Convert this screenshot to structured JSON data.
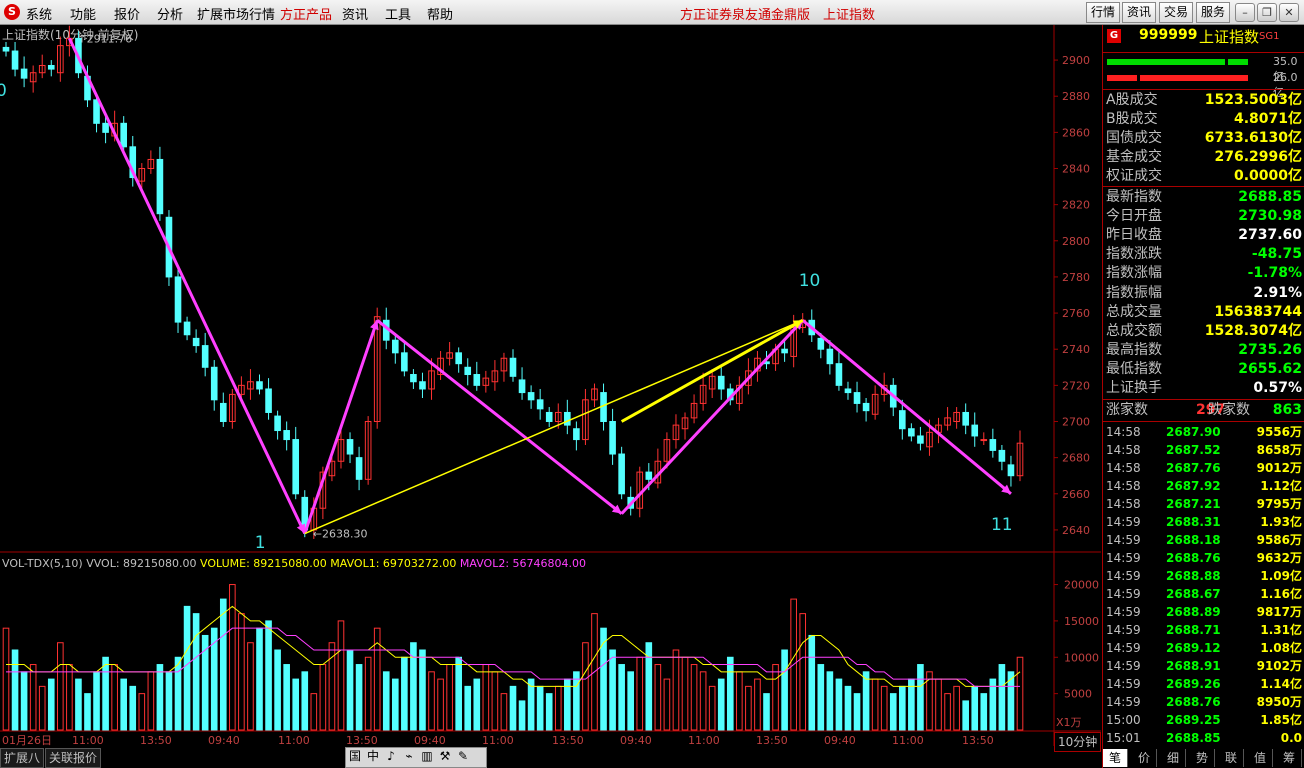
{
  "menu": {
    "items": [
      "系统",
      "功能",
      "报价",
      "分析",
      "扩展市场行情",
      "方正产品",
      "资讯",
      "工具",
      "帮助"
    ],
    "center_title": "方正证券泉友通金鼎版　上证指数",
    "right_buttons": [
      "行情",
      "资讯",
      "交易",
      "服务"
    ]
  },
  "chart": {
    "title": "上证指数(10分钟 前复权)",
    "high_label": "2911.76",
    "low_label": "2638.30",
    "wave_labels": [
      "0",
      "1",
      "10",
      "11"
    ],
    "price_axis": [
      "2900",
      "2880",
      "2860",
      "2840",
      "2820",
      "2800",
      "2780",
      "2760",
      "2740",
      "2720",
      "2700",
      "2680",
      "2660",
      "2640"
    ],
    "vol_axis": [
      "20000",
      "15000",
      "10000",
      "5000"
    ],
    "vol_unit": "X1万",
    "period": "10分钟",
    "time_axis": [
      "01月26日",
      "11:00",
      "13:50",
      "09:40",
      "11:00",
      "13:50",
      "09:40",
      "11:00",
      "13:50",
      "09:40",
      "11:00",
      "13:50",
      "09:40",
      "11:00",
      "13:50"
    ],
    "vol_header": {
      "name": "VOL-TDX(5,10)",
      "vvol": "VVOL: 89215080.00",
      "volume": "VOLUME: 89215080.00",
      "mavol1": "MAVOL1: 69703272.00",
      "mavol2": "MAVOL2: 56746804.00"
    },
    "colors": {
      "up": "#ff3232",
      "down": "#54ffff",
      "ma1": "#ffff00",
      "ma2": "#ff40ff",
      "trend": "#ff40ff",
      "yellow_line": "#ffff00",
      "grid": "#a00000"
    }
  },
  "bottom_tabs": [
    "扩展八",
    "关联报价"
  ],
  "toolstrip": [
    "国",
    "中",
    "♪",
    "⌁",
    "▥",
    "⚒",
    "✎"
  ],
  "panel": {
    "code": "999999",
    "name": "上证指数",
    "tag": "SG1",
    "bar1_label": "35.0亿",
    "bar2_label": "26.0亿",
    "turnover": [
      {
        "k": "A股成交",
        "v": "1523.5003亿"
      },
      {
        "k": "B股成交",
        "v": "4.8071亿"
      },
      {
        "k": "国债成交",
        "v": "6733.6130亿"
      },
      {
        "k": "基金成交",
        "v": "276.2996亿"
      },
      {
        "k": "权证成交",
        "v": "0.0000亿"
      }
    ],
    "stats": [
      {
        "k": "最新指数",
        "v": "2688.85",
        "c": "#00ff00"
      },
      {
        "k": "今日开盘",
        "v": "2730.98",
        "c": "#00ff00"
      },
      {
        "k": "昨日收盘",
        "v": "2737.60",
        "c": "#ffffff"
      },
      {
        "k": "指数涨跌",
        "v": "-48.75",
        "c": "#00ff00"
      },
      {
        "k": "指数涨幅",
        "v": "-1.78%",
        "c": "#00ff00"
      },
      {
        "k": "指数振幅",
        "v": "2.91%",
        "c": "#ffffff"
      },
      {
        "k": "总成交量",
        "v": "156383744",
        "c": "#ffff00"
      },
      {
        "k": "总成交额",
        "v": "1528.3074亿",
        "c": "#ffff00"
      },
      {
        "k": "最高指数",
        "v": "2735.26",
        "c": "#00ff00"
      },
      {
        "k": "最低指数",
        "v": "2655.62",
        "c": "#00ff00"
      },
      {
        "k": "上证换手",
        "v": "0.57%",
        "c": "#ffffff"
      }
    ],
    "updown": {
      "up_label": "涨家数",
      "up": "297",
      "down_label": "跌家数",
      "down": "863"
    },
    "ticks": [
      {
        "t": "14:58",
        "p": "2687.90",
        "q": "9556万"
      },
      {
        "t": "14:58",
        "p": "2687.52",
        "q": "8658万"
      },
      {
        "t": "14:58",
        "p": "2687.76",
        "q": "9012万"
      },
      {
        "t": "14:58",
        "p": "2687.92",
        "q": "1.12亿"
      },
      {
        "t": "14:58",
        "p": "2687.21",
        "q": "9795万"
      },
      {
        "t": "14:59",
        "p": "2688.31",
        "q": "1.93亿"
      },
      {
        "t": "14:59",
        "p": "2688.18",
        "q": "9586万"
      },
      {
        "t": "14:59",
        "p": "2688.76",
        "q": "9632万"
      },
      {
        "t": "14:59",
        "p": "2688.88",
        "q": "1.09亿"
      },
      {
        "t": "14:59",
        "p": "2688.67",
        "q": "1.16亿"
      },
      {
        "t": "14:59",
        "p": "2688.89",
        "q": "9817万"
      },
      {
        "t": "14:59",
        "p": "2688.71",
        "q": "1.31亿"
      },
      {
        "t": "14:59",
        "p": "2689.12",
        "q": "1.08亿"
      },
      {
        "t": "14:59",
        "p": "2688.91",
        "q": "9102万"
      },
      {
        "t": "14:59",
        "p": "2689.26",
        "q": "1.14亿"
      },
      {
        "t": "14:59",
        "p": "2688.76",
        "q": "8950万"
      },
      {
        "t": "15:00",
        "p": "2689.25",
        "q": "1.85亿"
      },
      {
        "t": "15:01",
        "p": "2688.85",
        "q": "0.0"
      }
    ],
    "tabs": [
      "笔",
      "价",
      "细",
      "势",
      "联",
      "值",
      "筹"
    ]
  },
  "kline_close_path": [
    2905,
    2895,
    2890,
    2893,
    2897,
    2895,
    2908,
    2912,
    2893,
    2878,
    2865,
    2860,
    2865,
    2852,
    2835,
    2840,
    2845,
    2815,
    2780,
    2755,
    2748,
    2742,
    2730,
    2712,
    2700,
    2715,
    2720,
    2722,
    2718,
    2705,
    2695,
    2690,
    2660,
    2640,
    2652,
    2672,
    2678,
    2690,
    2682,
    2668,
    2700,
    2758,
    2745,
    2738,
    2728,
    2722,
    2718,
    2728,
    2735,
    2738,
    2732,
    2726,
    2720,
    2724,
    2728,
    2735,
    2725,
    2716,
    2712,
    2707,
    2700,
    2705,
    2698,
    2690,
    2712,
    2718,
    2700,
    2682,
    2660,
    2652,
    2672,
    2668,
    2678,
    2690,
    2698,
    2702,
    2710,
    2720,
    2725,
    2718,
    2712,
    2720,
    2728,
    2735,
    2732,
    2740,
    2738,
    2752,
    2756,
    2748,
    2740,
    2732,
    2720,
    2716,
    2710,
    2706,
    2715,
    2720,
    2708,
    2696,
    2692,
    2688,
    2694,
    2698,
    2702,
    2705,
    2698,
    2692,
    2690,
    2684,
    2678,
    2670,
    2688
  ],
  "volume_values": [
    14,
    11,
    8,
    9,
    6,
    7,
    12,
    9,
    7,
    5,
    8,
    10,
    9,
    7,
    6,
    5,
    8,
    9,
    8,
    10,
    17,
    16,
    13,
    14,
    18,
    20,
    16,
    12,
    14,
    15,
    11,
    9,
    7,
    8,
    5,
    9,
    12,
    15,
    11,
    9,
    10,
    14,
    8,
    7,
    10,
    12,
    11,
    8,
    7,
    9,
    10,
    6,
    7,
    9,
    8,
    5,
    6,
    4,
    7,
    6,
    5,
    6,
    7,
    8,
    12,
    16,
    14,
    11,
    9,
    8,
    10,
    12,
    9,
    7,
    11,
    10,
    9,
    8,
    6,
    7,
    10,
    8,
    6,
    7,
    5,
    9,
    11,
    18,
    16,
    13,
    9,
    8,
    7,
    6,
    5,
    8,
    7,
    6,
    5,
    6,
    7,
    9,
    8,
    7,
    5,
    6,
    4,
    6,
    5,
    7,
    9,
    8,
    10
  ],
  "vol_ma1": [
    9,
    9,
    9,
    8,
    8,
    8,
    9,
    9,
    8,
    8,
    8,
    9,
    9,
    8,
    8,
    8,
    8,
    8,
    8,
    9,
    11,
    13,
    14,
    15,
    16,
    17,
    16,
    15,
    15,
    14,
    13,
    12,
    11,
    10,
    9,
    9,
    10,
    11,
    11,
    11,
    11,
    12,
    11,
    10,
    10,
    10,
    10,
    10,
    9,
    9,
    9,
    9,
    8,
    8,
    8,
    8,
    7,
    7,
    6,
    6,
    6,
    6,
    6,
    6,
    8,
    10,
    12,
    13,
    13,
    12,
    11,
    10,
    10,
    10,
    10,
    10,
    10,
    9,
    9,
    8,
    8,
    8,
    8,
    8,
    7,
    7,
    8,
    10,
    12,
    13,
    13,
    12,
    11,
    9,
    8,
    7,
    7,
    7,
    6,
    6,
    6,
    6,
    7,
    7,
    7,
    7,
    6,
    6,
    6,
    6,
    6,
    7,
    8
  ],
  "vol_ma2": [
    8,
    8,
    8,
    8,
    8,
    8,
    8,
    8,
    8,
    8,
    8,
    8,
    8,
    8,
    8,
    8,
    8,
    8,
    8,
    8,
    9,
    10,
    11,
    12,
    13,
    14,
    14,
    14,
    14,
    14,
    14,
    13,
    13,
    12,
    11,
    11,
    11,
    11,
    11,
    11,
    11,
    11,
    11,
    11,
    11,
    10,
    10,
    10,
    10,
    10,
    10,
    9,
    9,
    9,
    9,
    8,
    8,
    8,
    8,
    7,
    7,
    7,
    7,
    7,
    7,
    8,
    9,
    10,
    10,
    10,
    10,
    10,
    10,
    10,
    10,
    10,
    10,
    10,
    9,
    9,
    9,
    9,
    9,
    9,
    8,
    8,
    8,
    9,
    10,
    10,
    10,
    10,
    10,
    10,
    9,
    9,
    8,
    8,
    7,
    7,
    7,
    7,
    7,
    7,
    7,
    7,
    7,
    6,
    6,
    6,
    6,
    6,
    6
  ]
}
